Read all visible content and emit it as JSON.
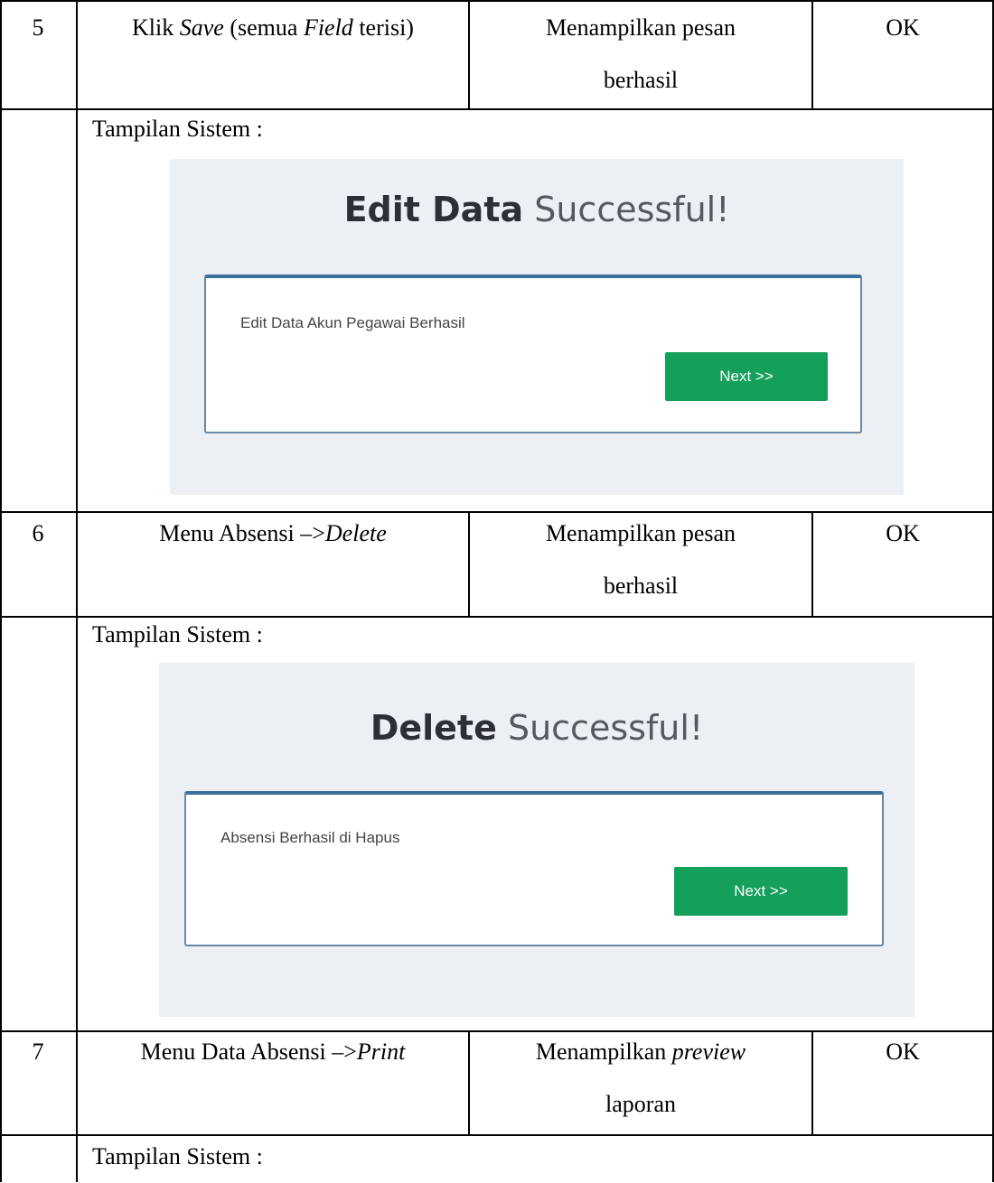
{
  "rows": [
    {
      "no": "5",
      "step_pre": "Klik ",
      "step_em1": "Save",
      "step_mid": " (semua ",
      "step_em2": "Field",
      "step_post": " terisi)",
      "expected_line1": "Menampilkan pesan",
      "expected_line2": "berhasil",
      "result": "OK"
    },
    {
      "no": "6",
      "step_pre": "Menu Absensi –>",
      "step_em1": "Delete",
      "expected_line1": "Menampilkan pesan",
      "expected_line2": "berhasil",
      "result": "OK"
    },
    {
      "no": "7",
      "step_pre": "Menu Data Absensi –>",
      "step_em1": "Print",
      "expected_line1_pre": "Menampilkan ",
      "expected_line1_em": "preview",
      "expected_line2": "laporan",
      "result": "OK"
    }
  ],
  "display_label": "Tampilan Sistem :",
  "screens": [
    {
      "title_bold": "Edit Data",
      "title_light": " Successful!",
      "message": "Edit Data Akun Pegawai Berhasil",
      "button": "Next >>"
    },
    {
      "title_bold": "Delete",
      "title_light": " Successful!",
      "message": "Absensi Berhasil di Hapus",
      "button": "Next >>"
    }
  ]
}
